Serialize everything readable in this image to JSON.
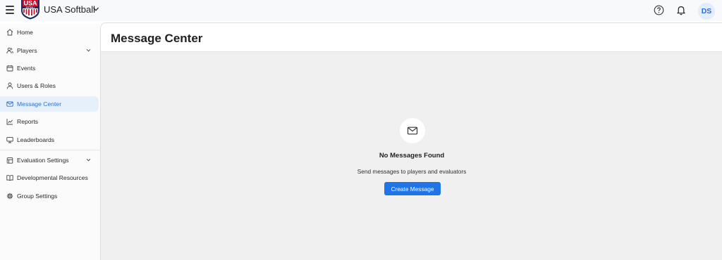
{
  "header": {
    "org_name": "USA Softball",
    "avatar_initials": "DS",
    "icons": [
      "menu-icon",
      "usa-softball-logo",
      "chevron-down-icon",
      "help-icon",
      "bell-icon"
    ]
  },
  "sidebar": {
    "items": [
      {
        "label": "Home",
        "icon": "home-icon"
      },
      {
        "label": "Players",
        "icon": "players-icon",
        "expandable": true
      },
      {
        "label": "Events",
        "icon": "calendar-icon"
      },
      {
        "label": "Users & Roles",
        "icon": "user-icon"
      },
      {
        "label": "Message Center",
        "icon": "mail-icon",
        "active": true
      },
      {
        "label": "Reports",
        "icon": "chart-icon"
      },
      {
        "label": "Leaderboards",
        "icon": "monitor-icon"
      },
      {
        "label": "Evaluation Settings",
        "icon": "clipboard-icon",
        "expandable": true
      },
      {
        "label": "Developmental Resources",
        "icon": "book-icon"
      },
      {
        "label": "Group Settings",
        "icon": "gear-icon"
      }
    ]
  },
  "main": {
    "title": "Message Center",
    "empty_state": {
      "icon": "mail-icon",
      "title": "No Messages Found",
      "subtitle": "Send messages to players and evaluators",
      "button_label": "Create Message"
    }
  },
  "colors": {
    "accent": "#1f74e8",
    "active_bg": "#e6f0fb",
    "active_text": "#2d6fd0",
    "content_bg": "#f0f0f0"
  }
}
